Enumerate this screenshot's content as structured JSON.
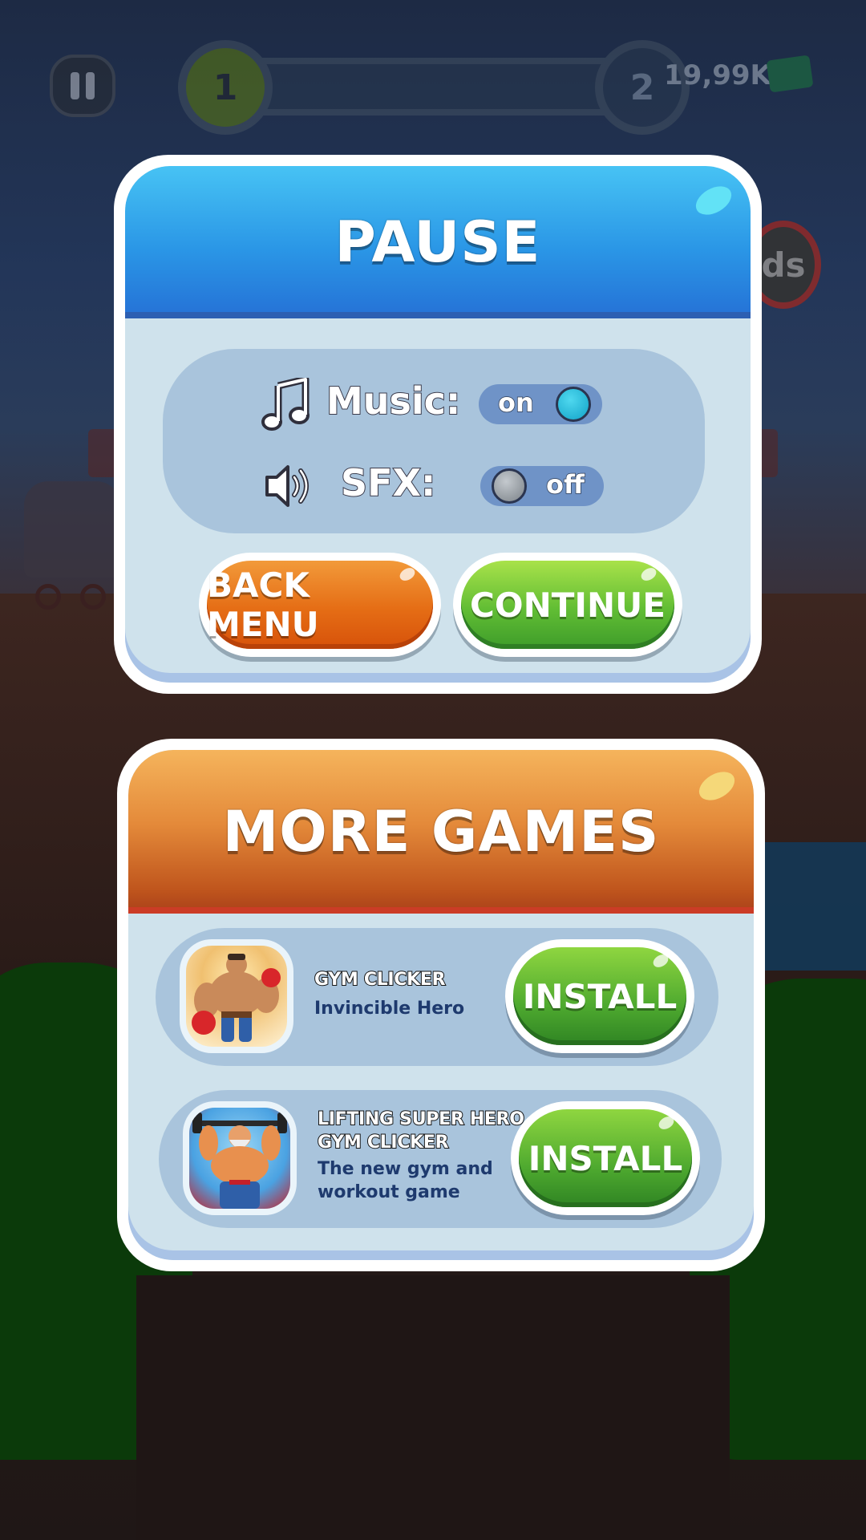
{
  "hud": {
    "level_current": "1",
    "level_next": "2",
    "cash": "19,99K",
    "ads_label": "ds"
  },
  "pause_panel": {
    "title": "PAUSE",
    "music": {
      "label": "Music:",
      "state": "on",
      "icon": "music-note-icon"
    },
    "sfx": {
      "label": "SFX:",
      "state": "off",
      "icon": "speaker-icon"
    },
    "back_button": "BACK MENU",
    "continue_button": "CONTINUE"
  },
  "games_panel": {
    "title": "MORE GAMES",
    "games": [
      {
        "name_line1": "GYM CLICKER",
        "name_line2": "",
        "desc_line1": "Invincible Hero",
        "desc_line2": "",
        "install_label": "INSTALL"
      },
      {
        "name_line1": "LIFTING SUPER HERO",
        "name_line2": "GYM CLICKER",
        "desc_line1": "The new gym and",
        "desc_line2": "workout game",
        "install_label": "INSTALL"
      }
    ]
  },
  "colors": {
    "pause_header": "#2a96e6",
    "games_header": "#e48a3a",
    "back_button": "#e56d15",
    "continue_button": "#61bd34",
    "install_button": "#4ea92f",
    "panel_body": "#cfe2ec",
    "card_bg": "#a9c4dc",
    "toggle_bg": "#6f93c7"
  }
}
